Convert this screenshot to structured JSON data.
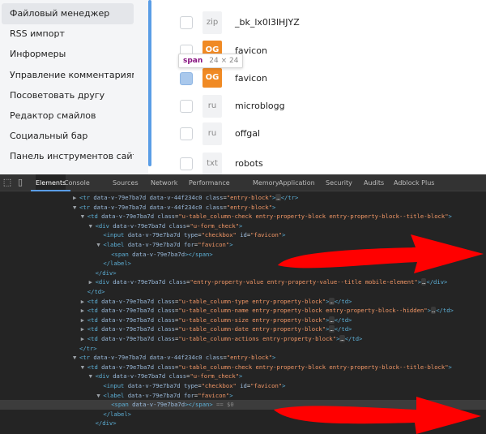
{
  "sidebar": {
    "items": [
      {
        "label": "Файловый менеджер",
        "active": true
      },
      {
        "label": "RSS импорт"
      },
      {
        "label": "Информеры"
      },
      {
        "label": "Управление комментариями"
      },
      {
        "label": "Посоветовать другу"
      },
      {
        "label": "Редактор смайлов"
      },
      {
        "label": "Социальный бар"
      },
      {
        "label": "Панель инструментов сайта"
      }
    ]
  },
  "files": [
    {
      "ext": "zip",
      "name": "_bk_lx0l3lHJYZ"
    },
    {
      "ext": "OG",
      "name": "favicon",
      "thumb": true
    },
    {
      "ext": "OG",
      "name": "favicon",
      "thumb": true,
      "highlight": true
    },
    {
      "ext": "ru",
      "name": "microblogg"
    },
    {
      "ext": "ru",
      "name": "offgal"
    },
    {
      "ext": "txt",
      "name": "robots"
    }
  ],
  "tooltip": {
    "tag": "span",
    "size": "24 × 24"
  },
  "devtools": {
    "tabs": [
      "Elements",
      "Console",
      "Sources",
      "Network",
      "Performance",
      "Memory",
      "Application",
      "Security",
      "Audits",
      "Adblock Plus"
    ],
    "active_tab": "Elements",
    "selected_suffix": "== $0"
  },
  "colors": {
    "accent": "#5a9de6",
    "thumb": "#f08a24",
    "arrow": "#ff0000",
    "devtools_bg": "#242424"
  }
}
